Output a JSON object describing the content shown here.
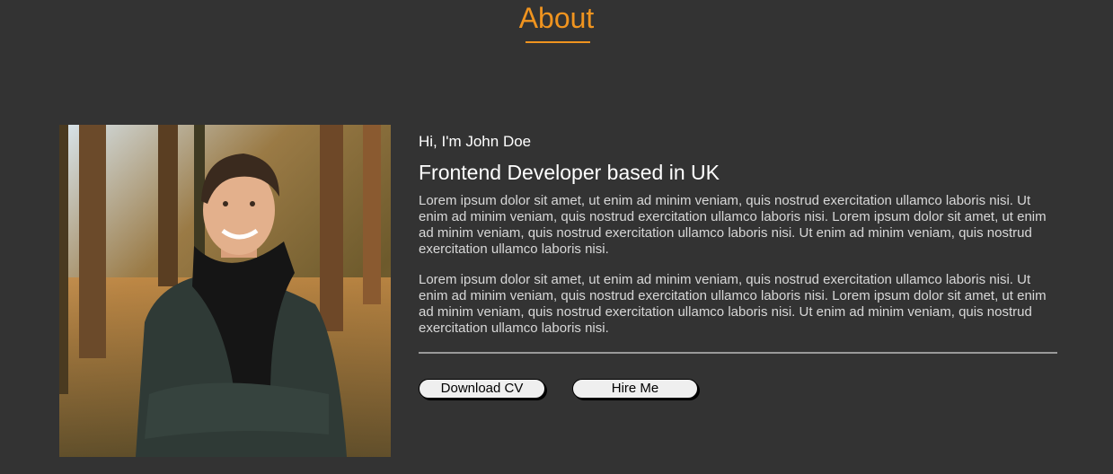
{
  "section": {
    "title": "About"
  },
  "profile": {
    "photo_alt": "Portrait photo",
    "greeting": "Hi, I'm John Doe",
    "role": "Frontend Developer based in UK",
    "paragraphs": [
      "Lorem ipsum dolor sit amet, ut enim ad minim veniam, quis nostrud exercitation ullamco laboris nisi. Ut enim ad minim veniam, quis nostrud exercitation ullamco laboris nisi. Lorem ipsum dolor sit amet, ut enim ad minim veniam, quis nostrud exercitation ullamco laboris nisi. Ut enim ad minim veniam, quis nostrud exercitation ullamco laboris nisi.",
      "Lorem ipsum dolor sit amet, ut enim ad minim veniam, quis nostrud exercitation ullamco laboris nisi. Ut enim ad minim veniam, quis nostrud exercitation ullamco laboris nisi. Lorem ipsum dolor sit amet, ut enim ad minim veniam, quis nostrud exercitation ullamco laboris nisi. Ut enim ad minim veniam, quis nostrud exercitation ullamco laboris nisi."
    ]
  },
  "actions": {
    "download_cv": "Download CV",
    "hire_me": "Hire Me"
  },
  "colors": {
    "background": "#333333",
    "accent": "#f0941f",
    "text": "#ffffff",
    "button_bg": "#efefef"
  }
}
